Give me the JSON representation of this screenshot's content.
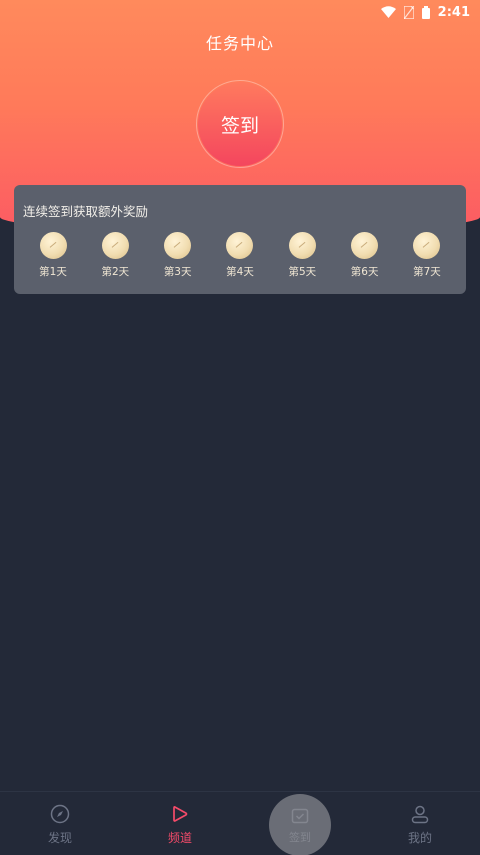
{
  "status": {
    "time": "2:41"
  },
  "header": {
    "title": "任务中心"
  },
  "signin": {
    "label": "签到"
  },
  "reward": {
    "title": "连续签到获取额外奖励",
    "days": [
      "第1天",
      "第2天",
      "第3天",
      "第4天",
      "第5天",
      "第6天",
      "第7天"
    ]
  },
  "tabs": [
    {
      "label": "发现",
      "icon": "compass-icon"
    },
    {
      "label": "频道",
      "icon": "play-icon"
    },
    {
      "label": "签到",
      "icon": "calendar-check-icon"
    },
    {
      "label": "我的",
      "icon": "user-icon"
    }
  ],
  "colors": {
    "accent": "#f54b6a",
    "background": "#232938",
    "card": "#5b606c"
  }
}
